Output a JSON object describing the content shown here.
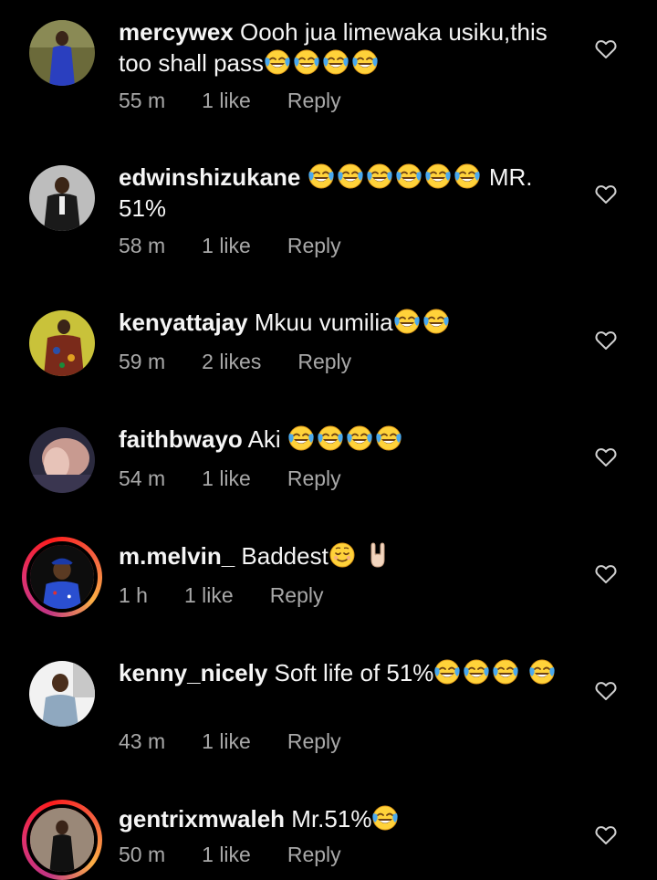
{
  "comments": [
    {
      "username": "mercywex",
      "text": "Oooh jua limewaka usiku,this too shall pass",
      "emojis_after": [
        "joy-tears",
        "joy-tears",
        "joy-tears",
        "joy-tears"
      ],
      "time": "55 m",
      "likes": "1 like",
      "reply": "Reply",
      "avatar": "woman-in-blue-dress"
    },
    {
      "username": "edwinshizukane",
      "text_before": "",
      "emojis_mid": [
        "joy-tears",
        "joy-tears",
        "joy-tears",
        "joy-tears",
        "joy-tears",
        "joy-tears"
      ],
      "text": "MR. 51%",
      "time": "58 m",
      "likes": "1 like",
      "reply": "Reply",
      "avatar": "man-in-suit"
    },
    {
      "username": "kenyattajay",
      "text": "Mkuu vumilia",
      "emojis_after": [
        "joy-tears",
        "joy-tears"
      ],
      "time": "59 m",
      "likes": "2 likes",
      "reply": "Reply",
      "avatar": "man-in-patterned-shirt"
    },
    {
      "username": "faithbwayo",
      "text": "Aki",
      "emojis_after": [
        "joy-tears",
        "joy-tears",
        "joy-tears",
        "joy-tears"
      ],
      "time": "54 m",
      "likes": "1 like",
      "reply": "Reply",
      "avatar": "person-closeup"
    },
    {
      "username": "m.melvin_",
      "text": "Baddest",
      "emojis_after": [
        "relieved-face",
        "rock-hand"
      ],
      "time": "1 h",
      "likes": "1 like",
      "reply": "Reply",
      "avatar": "man-with-cap",
      "story_ring": true
    },
    {
      "username": "kenny_nicely",
      "text": "Soft life of 51%",
      "emojis_after": [
        "joy-tears",
        "joy-tears",
        "joy-tears",
        "joy-tears"
      ],
      "time": "43 m",
      "likes": "1 like",
      "reply": "Reply",
      "avatar": "man-smiling"
    },
    {
      "username": "gentrixmwaleh",
      "text": "Mr.51%",
      "emojis_after": [
        "joy-tears"
      ],
      "time": "50 m",
      "likes": "1 like",
      "reply": "Reply",
      "avatar": "woman-standing",
      "story_ring": true
    }
  ],
  "icons": {
    "like": "heart-outline-icon"
  },
  "colors": {
    "background": "#000000",
    "text": "#f5f5f5",
    "meta": "#a8a8a8"
  }
}
